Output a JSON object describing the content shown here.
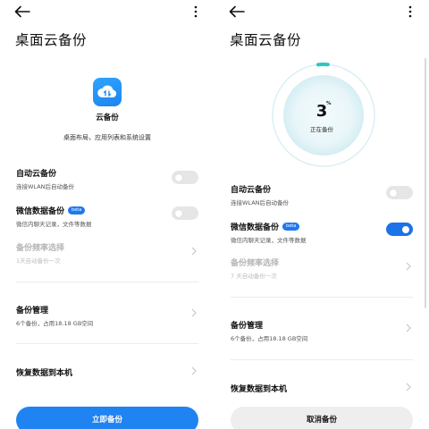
{
  "title": "桌面云备份",
  "app": {
    "name": "云备份",
    "description": "桌面布局，应用列表和系统设置",
    "icon": "cloud-backup-icon"
  },
  "progress": {
    "value": "3",
    "symbol": "%",
    "label": "正在备份"
  },
  "settings": {
    "auto_backup": {
      "title": "自动云备份",
      "sub": "连接WLAN后自动备份"
    },
    "wechat": {
      "title": "微信数据备份",
      "badge": "beta",
      "sub": "微信内聊天记录，文件等数据"
    },
    "frequency": {
      "title": "备份频率选择",
      "sub_left": "1天自动备份一次",
      "sub_right": "7 天自动备份一次"
    },
    "manage": {
      "title": "备份管理",
      "sub": "6个备份，占用18.18 GB空间"
    },
    "restore": {
      "title": "恢复数据到本机"
    }
  },
  "buttons": {
    "start": "立即备份",
    "cancel": "取消备份"
  },
  "colors": {
    "accent": "#1f84f2",
    "toggle_on": "#1b73e8",
    "progress": "#2ec4c4"
  }
}
